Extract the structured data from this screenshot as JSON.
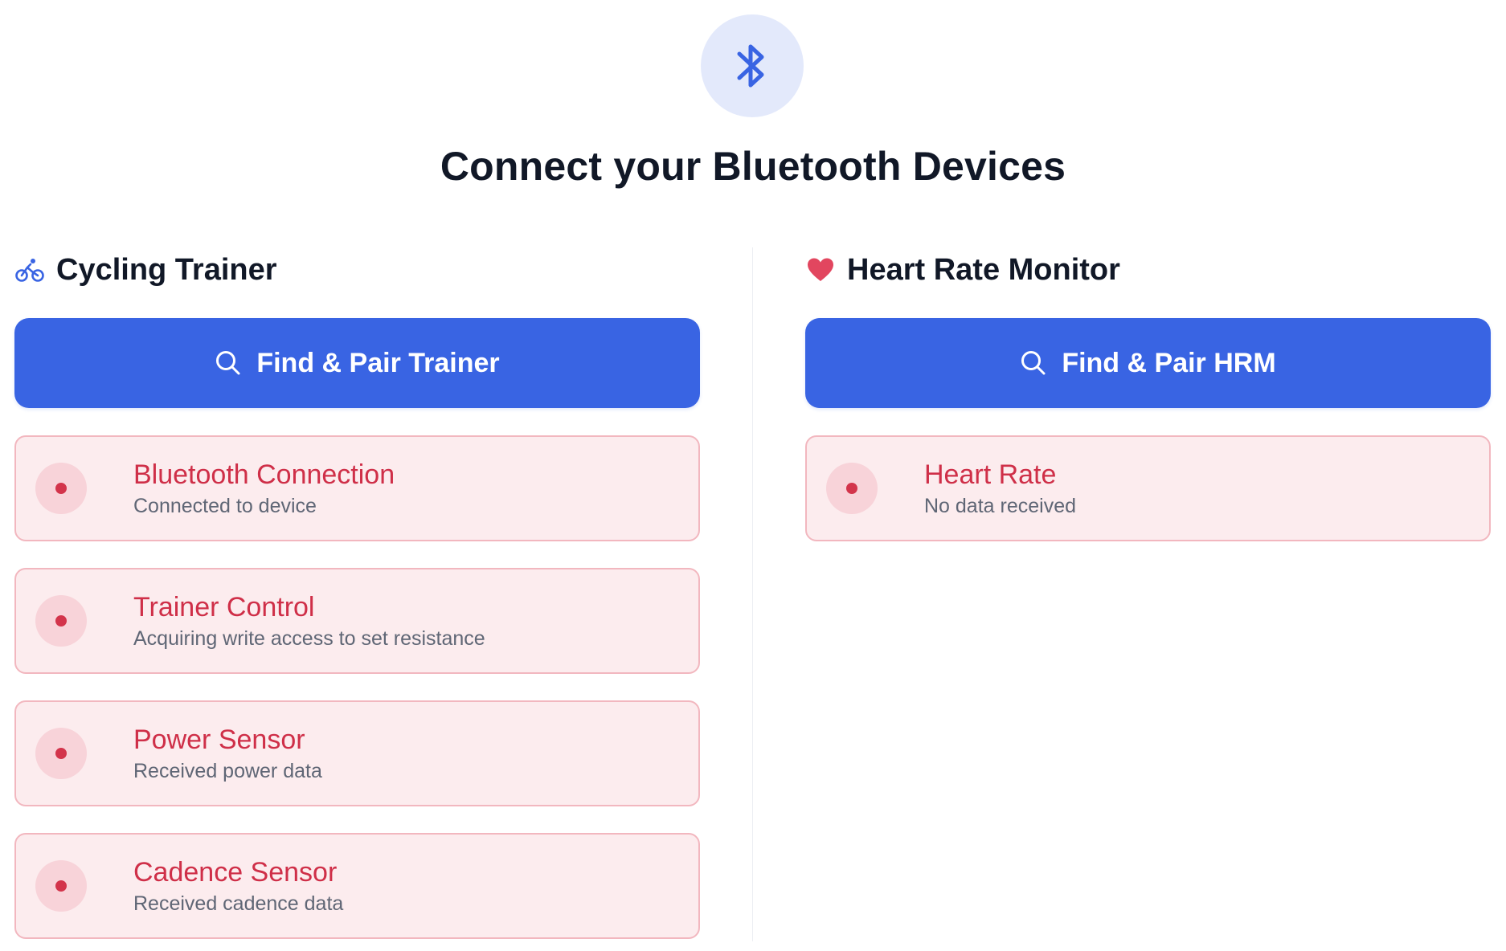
{
  "header": {
    "icon": "bluetooth-icon",
    "title": "Connect your Bluetooth Devices"
  },
  "colors": {
    "accent": "#3964e3",
    "error": "#cf2f48",
    "error_bg": "#fcecee",
    "heart": "#e2465f"
  },
  "trainer": {
    "icon": "bicycle-icon",
    "title": "Cycling Trainer",
    "button_icon": "search-icon",
    "button_label": "Find & Pair Trainer",
    "statuses": [
      {
        "title": "Bluetooth Connection",
        "subtitle": "Connected to device",
        "state": "error"
      },
      {
        "title": "Trainer Control",
        "subtitle": "Acquiring write access to set resistance",
        "state": "error"
      },
      {
        "title": "Power Sensor",
        "subtitle": "Received power data",
        "state": "error"
      },
      {
        "title": "Cadence Sensor",
        "subtitle": "Received cadence data",
        "state": "error"
      }
    ]
  },
  "hrm": {
    "icon": "heart-icon",
    "title": "Heart Rate Monitor",
    "button_icon": "search-icon",
    "button_label": "Find & Pair HRM",
    "statuses": [
      {
        "title": "Heart Rate",
        "subtitle": "No data received",
        "state": "error"
      }
    ]
  }
}
